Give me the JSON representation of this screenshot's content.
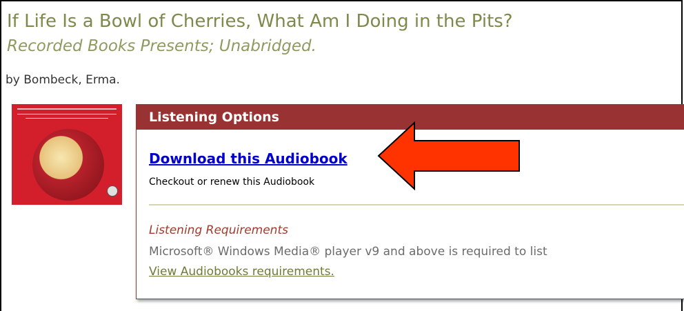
{
  "book": {
    "title": "If Life Is a Bowl of Cherries, What Am I Doing in the Pits?",
    "subtitle": "Recorded Books Presents; Unabridged.",
    "author": "by Bombeck, Erma."
  },
  "panel": {
    "header": "Listening Options",
    "download_label": "Download this Audiobook",
    "checkout_text": "Checkout or renew this Audiobook",
    "requirements_title": "Listening Requirements",
    "requirements_text": "Microsoft® Windows Media® player v9 and above is required to list",
    "requirements_link": "View Audiobooks requirements."
  },
  "colors": {
    "title": "#7e8a4c",
    "panel_header": "#993333",
    "link": "#0000cc",
    "arrow": "#ff3300"
  }
}
